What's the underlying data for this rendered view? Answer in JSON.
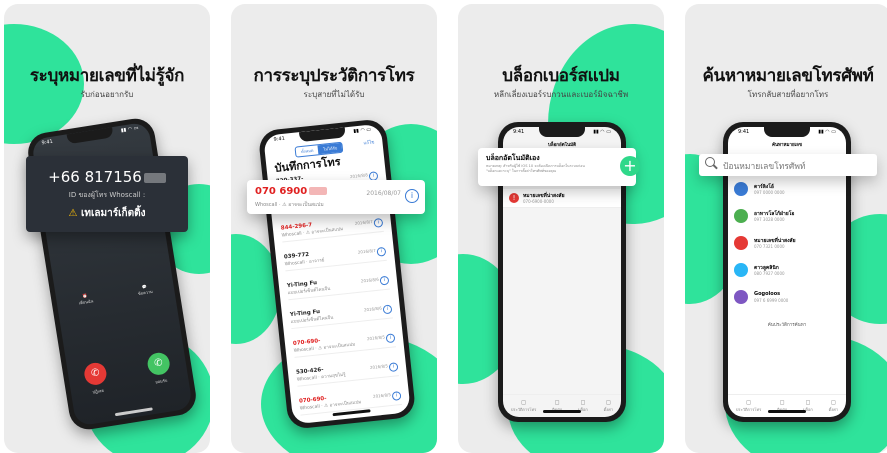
{
  "panels": [
    {
      "title": "ระบุหมายเลขที่ไม่รู้จัก",
      "subtitle": "รับก่อนอยากรับ",
      "call": {
        "time": "9:41",
        "number": "+66 817156",
        "id_line": "ID ของผู้โทร Whoscall :",
        "warning": "เทเลมาร์เก็ตติ้ง",
        "btn_left": "เตือนฉัน",
        "btn_right": "ข้อความ",
        "decline": "ปฏิเสธ",
        "accept": "ยอมรับ"
      }
    },
    {
      "title": "การระบุประวัติการโทร",
      "subtitle": "ระบุสายที่ไม่ได้รับ",
      "screen": {
        "time": "9:41",
        "seg_all": "ทั้งหมด",
        "seg_missed": "ไม่ได้รับ",
        "edit": "แก้ไข",
        "heading": "บันทึกการโทร",
        "highlight_number": "070 6900",
        "highlight_date": "2016/08/07",
        "highlight_sub": "Whoscall · ⚠ อาจจะเป็นสแปม",
        "rows": [
          {
            "name": "720-337-",
            "sub": "Whoscall · ค่าสมัครใจ",
            "date": "2016/8/8",
            "red": false
          },
          {
            "name": "844-296-7",
            "sub": "Whoscall · ⚠ อาจจะเป็นสแปม",
            "date": "2016/8/7",
            "red": true
          },
          {
            "name": "039-772",
            "sub": "Whoscall · อาจารย์",
            "date": "2016/8/7",
            "red": false
          },
          {
            "name": "Yi-Ting Fu",
            "sub": "แบบเปอร์เซ็นต์ไคนจีน",
            "date": "2016/8/6",
            "red": false
          },
          {
            "name": "Yi-Ting Fu",
            "sub": "แบบเปอร์เซ็นต์ไคนจีน",
            "date": "2016/8/6",
            "red": false
          },
          {
            "name": "070-690-",
            "sub": "Whoscall · ⚠ อาจจะเป็นสแปม",
            "date": "2016/8/5",
            "red": true
          },
          {
            "name": "530-426-",
            "sub": "Whoscall · ความสุขไม่รู้",
            "date": "2016/8/5",
            "red": false
          },
          {
            "name": "070-690-",
            "sub": "Whoscall · ⚠ อาจจะเป็นสแปม",
            "date": "2016/8/5",
            "red": true
          }
        ]
      }
    },
    {
      "title": "บล็อกเบอร์สแปม",
      "subtitle": "หลีกเลี่ยงเบอร์รบกวนและเบอร์มิจฉาชีพ",
      "screen": {
        "time": "9:41",
        "header": "บล็อกอัตโนมัติ",
        "card_title": "บล็อกอัตโนมัติเอง",
        "card_text": "หมายเหตุ: สำหรับผู้ใช้ iOS 10 จะต้องเปิดการบล็อกในระบบก่อน \"บล็อกและระบุ\" ในการตั้งค่าโทรศัพท์ของคุณ",
        "blocked_name": "หมายเลขที่น่าสงสัย",
        "blocked_sub": "070-6900-0000",
        "tabs": [
          "ประวัติการโทร",
          "ติดต่อ",
          "บล็อก",
          "ตั้งค่า"
        ]
      }
    },
    {
      "title": "ค้นหาหมายเลขโทรศัพท์",
      "subtitle": "โทรกลับสายที่อยากโทร",
      "screen": {
        "time": "9:41",
        "header": "ค้นหาหมายเลข",
        "search_placeholder": "ป้อนหมายเลขโทรศัพท์",
        "results": [
          {
            "name": "ดาร์ลิงโอ้",
            "sub": "097 0000 0000",
            "color": "#3a7bd5"
          },
          {
            "name": "อาหารโลโก้ฝ่ายโอ",
            "sub": "097 3028 0000",
            "color": "#4caf50"
          },
          {
            "name": "หมายเลขที่น่าสงสัย",
            "sub": "070 7321 0000",
            "color": "#e53935"
          },
          {
            "name": "ตาวลูคลินิก",
            "sub": "080 7927 0000",
            "color": "#29b6f6"
          },
          {
            "name": "Gogoloos",
            "sub": "097 6 6999 0000",
            "color": "#7e57c2"
          }
        ],
        "more": "ค้นประวัติการค้นหา",
        "tabs": [
          "ประวัติการโทร",
          "ติดต่อ",
          "บล็อก",
          "ตั้งค่า"
        ]
      }
    }
  ]
}
